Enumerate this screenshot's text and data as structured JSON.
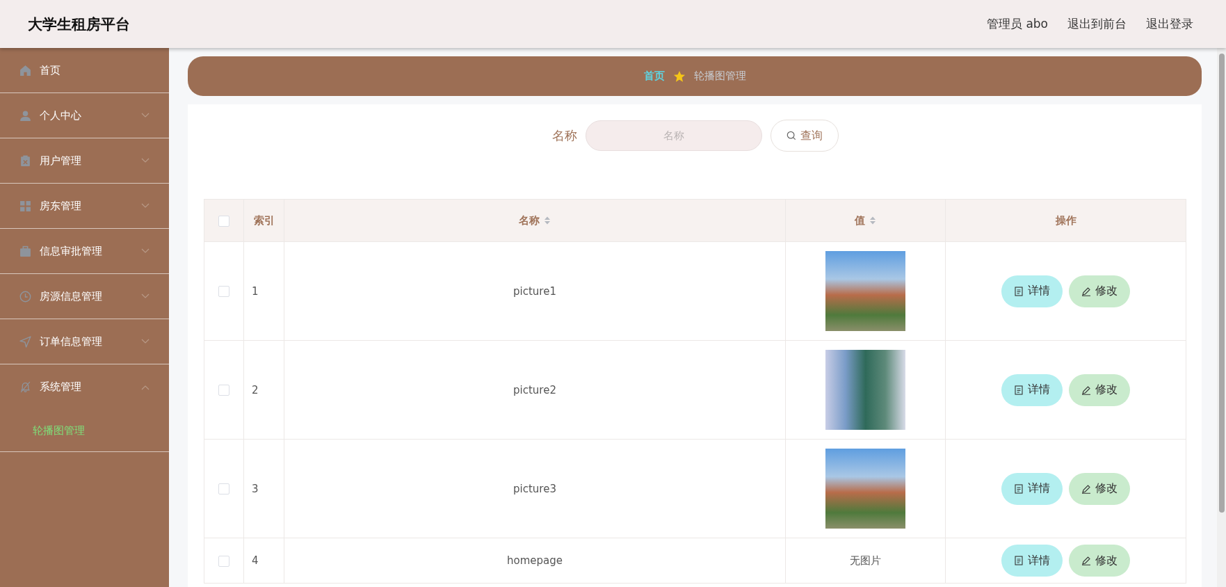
{
  "header": {
    "title": "大学生租房平台",
    "links": [
      "管理员 abo",
      "退出到前台",
      "退出登录"
    ]
  },
  "sidebar": {
    "items": [
      {
        "label": "首页",
        "kind": "link"
      },
      {
        "label": "个人中心",
        "kind": "menu",
        "expanded": false
      },
      {
        "label": "用户管理",
        "kind": "menu",
        "expanded": false
      },
      {
        "label": "房东管理",
        "kind": "menu",
        "expanded": false
      },
      {
        "label": "信息审批管理",
        "kind": "menu",
        "expanded": false
      },
      {
        "label": "房源信息管理",
        "kind": "menu",
        "expanded": false
      },
      {
        "label": "订单信息管理",
        "kind": "menu",
        "expanded": false
      },
      {
        "label": "系统管理",
        "kind": "menu",
        "expanded": true,
        "children": [
          {
            "label": "轮播图管理",
            "selected": true
          }
        ]
      }
    ]
  },
  "breadcrumb": [
    "首页",
    "轮播图管理"
  ],
  "search": {
    "label": "名称",
    "placeholder": "名称",
    "button": "查询"
  },
  "table": {
    "columns": [
      {
        "label": "索引",
        "sortable": false
      },
      {
        "label": "名称",
        "sortable": true
      },
      {
        "label": "值",
        "sortable": true
      },
      {
        "label": "操作",
        "sortable": false
      }
    ],
    "header_checked": false,
    "rows": [
      {
        "checked": false,
        "index": "1",
        "name": "picture1",
        "value": {
          "kind": "image"
        },
        "actions": [
          "详情",
          "修改"
        ]
      },
      {
        "checked": false,
        "index": "2",
        "name": "picture2",
        "value": {
          "kind": "image"
        },
        "actions": [
          "详情",
          "修改"
        ]
      },
      {
        "checked": false,
        "index": "3",
        "name": "picture3",
        "value": {
          "kind": "image"
        },
        "actions": [
          "详情",
          "修改"
        ]
      },
      {
        "checked": false,
        "index": "4",
        "name": "homepage",
        "value": {
          "kind": "text",
          "text": "无图片"
        },
        "actions": [
          "详情",
          "修改"
        ]
      }
    ]
  }
}
